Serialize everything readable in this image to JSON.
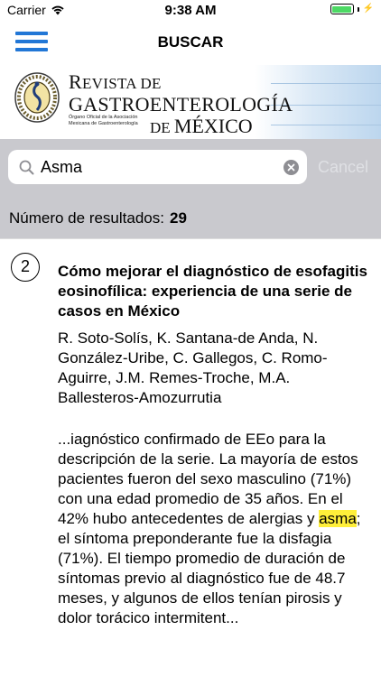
{
  "status_bar": {
    "carrier": "Carrier",
    "time": "9:38 AM"
  },
  "nav": {
    "title": "BUSCAR"
  },
  "journal": {
    "line1_a": "R",
    "line1_b": "EVISTA DE",
    "line2": "GASTROENTEROLOGÍA",
    "line3_a": "DE ",
    "line3_b": "MÉXICO",
    "organ": "Órgano Oficial de la Asociación Mexicana de Gastroenterología"
  },
  "search": {
    "value": "Asma",
    "cancel_label": "Cancel"
  },
  "results": {
    "count_label": "Número de resultados:",
    "count": "29"
  },
  "result": {
    "index": "2",
    "title": "Cómo mejorar el diagnóstico de esofagitis eosinofílica: experiencia de una serie de casos en México",
    "authors": "R. Soto-Solís, K. Santana-de Anda, N. González-Uribe, C. Gallegos, C. Romo-Aguirre, J.M. Remes-Troche, M.A. Ballesteros-Amozurrutia",
    "snippet_before": "...iagnóstico confirmado de EEo para la descripción de la serie. La mayoría de estos pacientes fueron del sexo masculino (71%) con una edad promedio de 35 años. En el 42% hubo antecedentes de alergias y ",
    "snippet_highlight": "asma",
    "snippet_after": "; el síntoma preponderante fue la disfagia (71%). El tiempo promedio de duración de síntomas previo al diagnóstico fue de 48.7 meses, y algunos de ellos tenían pirosis y dolor torácico intermitent..."
  },
  "colors": {
    "accent": "#2277d6",
    "search_bg": "#c9c9ce",
    "highlight": "#ffef3a",
    "battery": "#4cd964"
  }
}
